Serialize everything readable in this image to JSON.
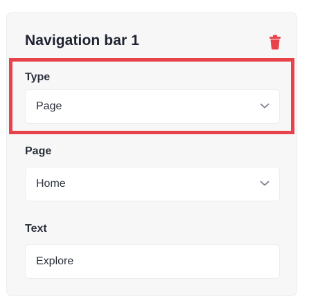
{
  "panel": {
    "title": "Navigation bar 1",
    "delete_icon": "trash-icon",
    "accent_color": "#e8434b"
  },
  "fields": {
    "type": {
      "label": "Type",
      "value": "Page",
      "icon": "chevron-down-icon"
    },
    "page": {
      "label": "Page",
      "value": "Home",
      "icon": "chevron-down-icon"
    },
    "text": {
      "label": "Text",
      "value": "Explore"
    }
  }
}
